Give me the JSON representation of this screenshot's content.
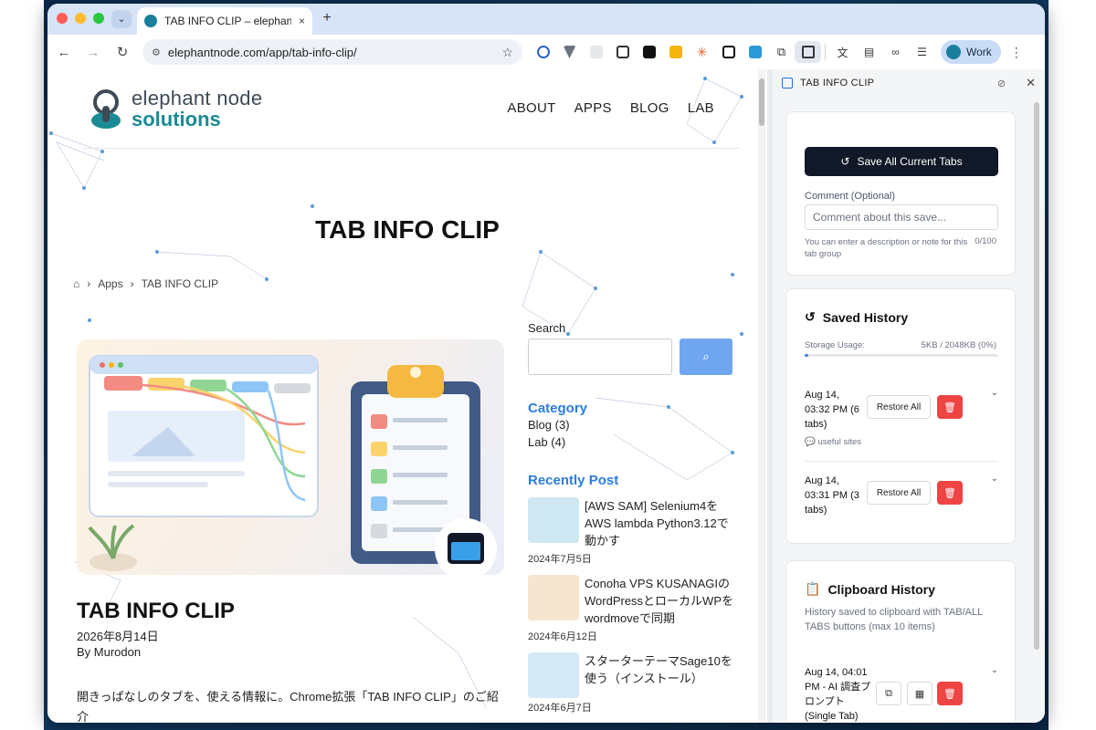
{
  "browser": {
    "tab_title": "TAB INFO CLIP – elephantnode",
    "tab_close": "×",
    "new_tab": "+",
    "tab_menu": "⌄",
    "url": "elephantnode.com/app/tab-info-clip/",
    "profile": "Work",
    "back": "←",
    "forward": "→",
    "reload": "↻",
    "star": "☆",
    "menu": "⋮"
  },
  "site": {
    "logo_line1": "elephant node",
    "logo_line2": "solutions",
    "nav": [
      "ABOUT",
      "APPS",
      "BLOG",
      "LAB"
    ],
    "page_heading": "TAB INFO CLIP",
    "breadcrumb": [
      "Apps",
      "TAB INFO CLIP"
    ],
    "post_title": "TAB INFO CLIP",
    "post_date": "2026年8月14日",
    "post_author": "By Murodon",
    "post_intro": "開きっぱなしのタブを、使える情報に。Chrome拡張「TAB INFO CLIP」のご紹介"
  },
  "sidebar": {
    "search_label": "Search",
    "category_heading": "Category",
    "categories": [
      "Blog (3)",
      "Lab (4)"
    ],
    "recent_heading": "Recently Post",
    "recent_posts": [
      {
        "title": "[AWS SAM] Selenium4をAWS lambda Python3.12で動かす",
        "date": "2024年7月5日"
      },
      {
        "title": "Conoha VPS KUSANAGIのWordPressとローカルWPをwordmoveで同期",
        "date": "2024年6月12日"
      },
      {
        "title": "スターターテーマSage10を使う（インストール）",
        "date": "2024年6月7日"
      }
    ]
  },
  "panel": {
    "title": "TAB INFO CLIP",
    "save_button": "Save All Current Tabs",
    "comment_label": "Comment (Optional)",
    "comment_placeholder": "Comment about this save...",
    "comment_help": "You can enter a description or note for this tab group",
    "comment_count": "0/100",
    "history_title": "Saved History",
    "storage_label": "Storage Usage:",
    "storage_value": "5KB / 2048KB (0%)",
    "storage_fraction": 0.0024,
    "history_items": [
      {
        "when": "Aug 14, 03:32 PM (6 tabs)",
        "note": "useful sites",
        "restore": "Restore All"
      },
      {
        "when": "Aug 14, 03:31 PM (3 tabs)",
        "note": "",
        "restore": "Restore All"
      }
    ],
    "clipboard_title": "Clipboard History",
    "clipboard_desc": "History saved to clipboard with TAB/ALL TABS buttons (max 10 items)",
    "clipboard_items": [
      {
        "when": "Aug 14, 04:01 PM - AI 調査プロンプト (Single Tab)"
      }
    ]
  },
  "colors": {
    "accent": "#2a7de1",
    "panel_dark": "#111827",
    "danger": "#ef4444",
    "brand_teal": "#1a8b94"
  }
}
